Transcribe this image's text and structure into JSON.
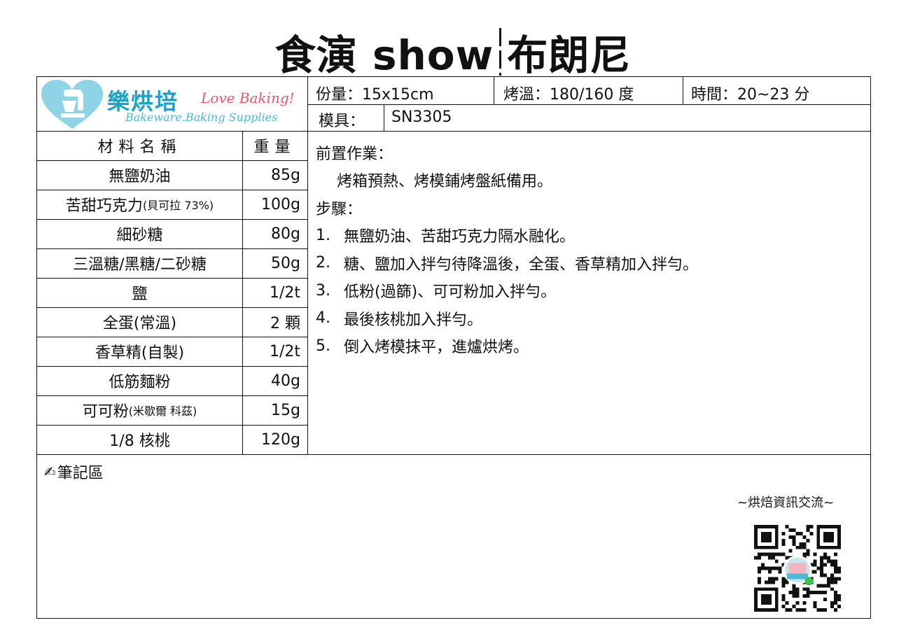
{
  "title": {
    "left": "食演 show",
    "right": "布朗尼"
  },
  "logo": {
    "zh": "樂烘培",
    "en": "Love Baking!",
    "sub": "Bakeware.Baking Supplies"
  },
  "info": {
    "servings": "份量：15x15cm",
    "temperature": "烤溫：180/160 度",
    "time": "時間：20~23 分",
    "mold_label": "模具：",
    "mold_value": "SN3305"
  },
  "ingredients": {
    "header": {
      "name": "材料名稱",
      "qty": "重量"
    },
    "rows": [
      {
        "name": "無鹽奶油",
        "note": "",
        "qty": "85g"
      },
      {
        "name": "苦甜巧克力",
        "note": "(貝可拉 73%)",
        "qty": "100g"
      },
      {
        "name": "細砂糖",
        "note": "",
        "qty": "80g"
      },
      {
        "name": "三溫糖/黑糖/二砂糖",
        "note": "",
        "qty": "50g"
      },
      {
        "name": "鹽",
        "note": "",
        "qty": "1/2t"
      },
      {
        "name": "全蛋(常溫)",
        "note": "",
        "qty": "2 顆"
      },
      {
        "name": "香草精(自製)",
        "note": "",
        "qty": "1/2t"
      },
      {
        "name": "低筋麵粉",
        "note": "",
        "qty": "40g"
      },
      {
        "name": "可可粉",
        "note": "(米歇爾 科茲)",
        "qty": "15g"
      },
      {
        "name": "1/8 核桃",
        "note": "",
        "qty": "120g"
      }
    ]
  },
  "prep": {
    "heading": "前置作業：",
    "text": "烤箱預熱、烤模鋪烤盤紙備用。"
  },
  "steps": {
    "heading": "步驟：",
    "items": [
      {
        "num": "1.",
        "text": "無鹽奶油、苦甜巧克力隔水融化。"
      },
      {
        "num": "2.",
        "text": "糖、鹽加入拌勻待降溫後，全蛋、香草精加入拌勻。"
      },
      {
        "num": "3.",
        "text": "低粉(過篩)、可可粉加入拌勻。"
      },
      {
        "num": "4.",
        "text": "最後核桃加入拌勻。"
      },
      {
        "num": "5.",
        "text": "倒入烤模抹平，進爐烘烤。"
      }
    ]
  },
  "notes": {
    "icon": "pencil-writing-icon",
    "label": "筆記區"
  },
  "qr": {
    "label": "~烘焙資訊交流~",
    "icon": "qr-code-icon"
  }
}
